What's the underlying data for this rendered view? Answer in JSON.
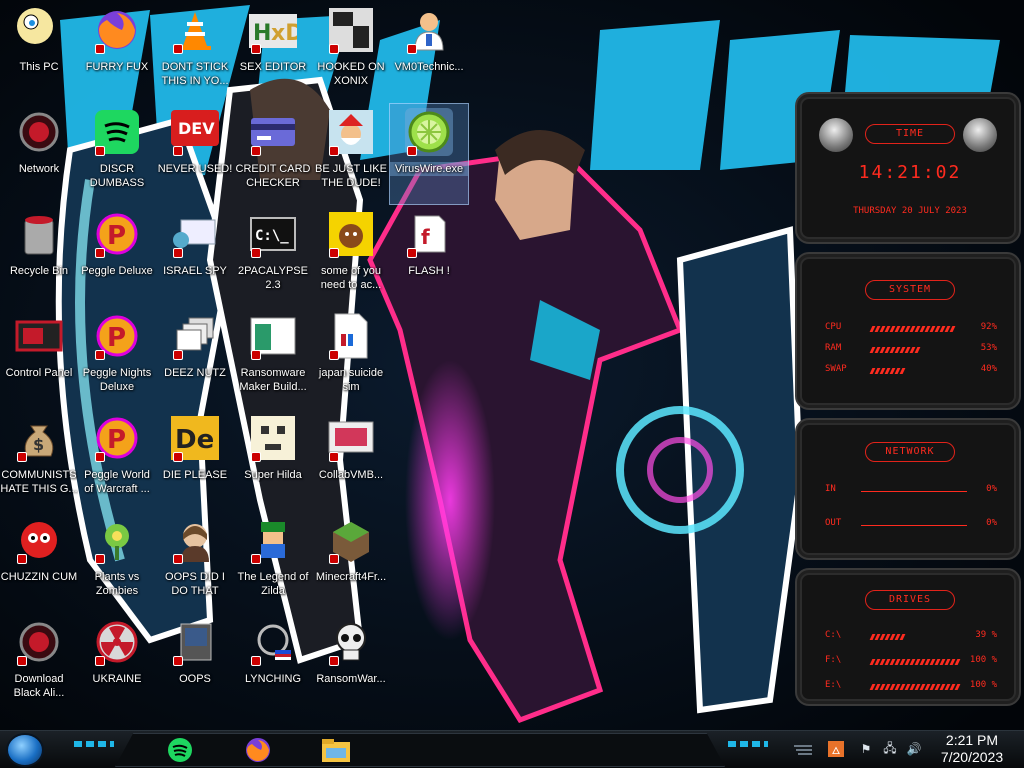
{
  "desktop": {
    "icons": [
      {
        "label": "This PC",
        "icon": "this-pc-icon"
      },
      {
        "label": "FURRY FUX",
        "icon": "firefox-icon"
      },
      {
        "label": "DONT STICK THIS IN YO...",
        "icon": "vlc-icon"
      },
      {
        "label": "SEX EDITOR",
        "icon": "hxd-icon"
      },
      {
        "label": "HOOKED ON XONIX",
        "icon": "xonix-icon"
      },
      {
        "label": "VM0Technic...",
        "icon": "doctor-icon"
      },
      {
        "label": "Network",
        "icon": "network-icon"
      },
      {
        "label": "DISCR DUMBASS",
        "icon": "spotify-icon"
      },
      {
        "label": "NEVER USED!",
        "icon": "devcpp-icon"
      },
      {
        "label": "CREDIT CARD CHECKER",
        "icon": "credit-card-icon"
      },
      {
        "label": "BE JUST LIKE THE DUDE!",
        "icon": "santa-icon"
      },
      {
        "label": "VirusWire.exe",
        "icon": "limewire-icon"
      },
      {
        "label": "Recycle Bin",
        "icon": "recycle-bin-icon"
      },
      {
        "label": "Peggle Deluxe",
        "icon": "peggle-icon"
      },
      {
        "label": "ISRAEL SPY",
        "icon": "spy-icon"
      },
      {
        "label": "2PACALYPSE 2.3",
        "icon": "terminal-icon"
      },
      {
        "label": "some of you need to ac...",
        "icon": "dog-icon"
      },
      {
        "label": "FLASH !",
        "icon": "flash-icon"
      },
      {
        "label": "Control Panel",
        "icon": "control-panel-icon"
      },
      {
        "label": "Peggle Nights Deluxe",
        "icon": "peggle-icon"
      },
      {
        "label": "DEEZ NUTZ",
        "icon": "windows-stack-icon"
      },
      {
        "label": "Ransomware Maker Build...",
        "icon": "ransomware-icon"
      },
      {
        "label": "japan suicide sim",
        "icon": "file-icon"
      },
      {
        "label": "COMMUNISTS HATE THIS G...",
        "icon": "money-bag-icon"
      },
      {
        "label": "Peggle World of Warcraft ...",
        "icon": "peggle-icon"
      },
      {
        "label": "DIE PLEASE",
        "icon": "de-icon"
      },
      {
        "label": "Super Hilda",
        "icon": "pixel-icon"
      },
      {
        "label": "CollabVMB...",
        "icon": "collabvm-icon"
      },
      {
        "label": "CHUZZIN CUM",
        "icon": "chuzzle-icon"
      },
      {
        "label": "Plants vs Zombies",
        "icon": "pvz-icon"
      },
      {
        "label": "OOPS DID I DO THAT",
        "icon": "portrait-icon"
      },
      {
        "label": "The Legend of Zilda",
        "icon": "zelda-icon"
      },
      {
        "label": "Minecraft4Fr...",
        "icon": "minecraft-icon"
      },
      {
        "label": "Download Black Ali...",
        "icon": "alien-icon"
      },
      {
        "label": "UKRAINE",
        "icon": "radiation-icon"
      },
      {
        "label": "OOPS",
        "icon": "oops-icon"
      },
      {
        "label": "LYNCHING",
        "icon": "network-globe-icon"
      },
      {
        "label": "RansomWar...",
        "icon": "skull-icon"
      }
    ]
  },
  "gadget": {
    "time_title": "TIME",
    "time": "14:21:02",
    "date": "THURSDAY 20 JULY 2023",
    "system_title": "SYSTEM",
    "system_rows": [
      {
        "name": "CPU",
        "value": "92%",
        "level": 0.92
      },
      {
        "name": "RAM",
        "value": "53%",
        "level": 0.53
      },
      {
        "name": "SWAP",
        "value": "40%",
        "level": 0.4
      }
    ],
    "network_title": "NETWORK",
    "network_rows": [
      {
        "name": "IN",
        "value": "0%"
      },
      {
        "name": "OUT",
        "value": "0%"
      }
    ],
    "drives_title": "DRIVES",
    "drive_rows": [
      {
        "name": "C:\\",
        "value": "39 %",
        "level": 0.39
      },
      {
        "name": "F:\\",
        "value": "100 %",
        "level": 1.0
      },
      {
        "name": "E:\\",
        "value": "100 %",
        "level": 1.0
      }
    ]
  },
  "taskbar": {
    "apps": [
      "spotify-icon",
      "firefox-icon",
      "file-explorer-icon"
    ],
    "tray_icons": [
      "tray-flame-icon",
      "flag-icon",
      "network-icon",
      "volume-icon"
    ],
    "clock_time": "2:21 PM",
    "clock_date": "7/20/2023"
  },
  "colors": {
    "accent": "#ff2b1f",
    "wallpaper_cyan": "#21b8e8",
    "wallpaper_pink": "#e0177a"
  }
}
